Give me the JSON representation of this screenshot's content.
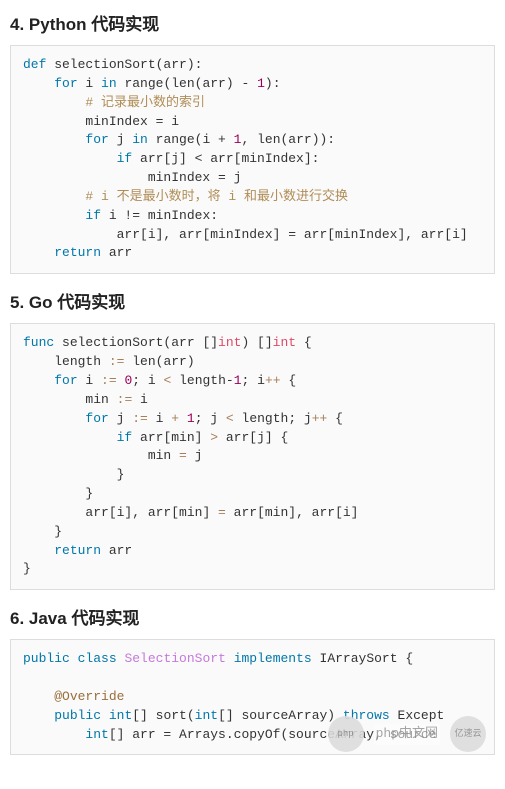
{
  "sections": {
    "python": {
      "heading": "4. Python 代码实现",
      "code": {
        "l1": {
          "kw_def": "def",
          "name": " selectionSort(arr):"
        },
        "l2": {
          "kw_for": "for",
          "var": " i ",
          "kw_in": "in",
          "range": " range(len(arr) - ",
          "num1": "1",
          "tail": "):"
        },
        "l3": {
          "cmt": "# 记录最小数的索引"
        },
        "l4": {
          "txt": "minIndex = i"
        },
        "l5": {
          "kw_for": "for",
          "var": " j ",
          "kw_in": "in",
          "range": " range(i + ",
          "num1": "1",
          "mid": ", len(arr)):"
        },
        "l6": {
          "kw_if": "if",
          "cond": " arr[j] < arr[minIndex]:"
        },
        "l7": {
          "txt": "minIndex = j"
        },
        "l8": {
          "cmt": "# i 不是最小数时，将 i 和最小数进行交换"
        },
        "l9": {
          "kw_if": "if",
          "cond": " i != minIndex:"
        },
        "l10": {
          "txt": "arr[i], arr[minIndex] = arr[minIndex], arr[i]"
        },
        "l11": {
          "kw_return": "return",
          "txt": " arr"
        }
      }
    },
    "go": {
      "heading": "5. Go 代码实现",
      "code": {
        "l1": {
          "kw_func": "func",
          "name": " selectionSort(arr []",
          "type1": "int",
          "mid": ") []",
          "type2": "int",
          "tail": " {"
        },
        "l2": {
          "txt": "length ",
          "op": ":=",
          "txt2": " len(arr)"
        },
        "l3": {
          "kw_for": "for",
          "txt": " i ",
          "op1": ":=",
          "sp": " ",
          "num0": "0",
          "semi": "; i ",
          "oplt": "<",
          "txt2": " length-",
          "num1b": "1",
          "semi2": "; i",
          "opinc": "++",
          "tail": " {"
        },
        "l4": {
          "txt": "min ",
          "op": ":=",
          "txt2": " i"
        },
        "l5": {
          "kw_for": "for",
          "txt": " j ",
          "op1": ":=",
          "txt2": " i ",
          "opplus": "+",
          "sp2": " ",
          "num1": "1",
          "semi": "; j ",
          "oplt": "<",
          "txt3": " length; j",
          "opinc": "++",
          "tail": " {"
        },
        "l6": {
          "kw_if": "if",
          "txt": " arr[min] ",
          "opgt": ">",
          "txt2": " arr[j] {"
        },
        "l7": {
          "txt": "min ",
          "opeq": "=",
          "txt2": " j"
        },
        "l8": {
          "txt": "}"
        },
        "l9": {
          "txt": "}"
        },
        "l10": {
          "txt": "arr[i], arr[min] ",
          "opeq": "=",
          "txt2": " arr[min], arr[i]"
        },
        "l11": {
          "txt": "}"
        },
        "l12": {
          "kw_return": "return",
          "txt": " arr"
        },
        "l13": {
          "txt": "}"
        }
      }
    },
    "java": {
      "heading": "6. Java 代码实现",
      "code": {
        "l1": {
          "kw_public": "public",
          "sp": " ",
          "kw_class": "class",
          "sp2": " ",
          "cls": "SelectionSort",
          "sp3": " ",
          "kw_impl": "implements",
          "sp4": " ",
          "iface": "IArraySort",
          "tail": " {"
        },
        "l2": {
          "ann": "@Override"
        },
        "l3": {
          "kw_public": "public",
          "sp": " ",
          "kw_int": "int",
          "arr": "[] sort(",
          "kw_int2": "int",
          "arr2": "[] sourceArray) ",
          "kw_throws": "throws",
          "tail": " Except"
        },
        "l4": {
          "kw_int": "int",
          "txt": "[] arr = Arrays.copyOf(sourceArray, source"
        }
      }
    }
  },
  "watermark": {
    "badge1": "php",
    "text1": "php中文网",
    "badge2": "亿速云"
  }
}
